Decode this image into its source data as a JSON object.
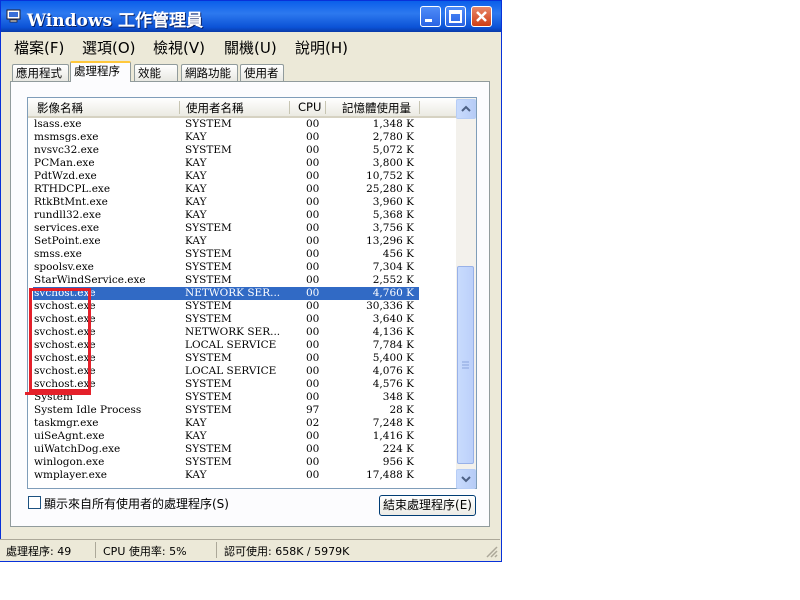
{
  "window": {
    "title": "Windows 工作管理員",
    "icon": "monitor-icon",
    "controls": [
      "minimize-icon",
      "maximize-icon",
      "close-icon"
    ]
  },
  "menu": [
    "檔案(F)",
    "選項(O)",
    "檢視(V)",
    "關機(U)",
    "說明(H)"
  ],
  "tabs": [
    {
      "label": "應用程式",
      "active": false
    },
    {
      "label": "處理程序",
      "active": true
    },
    {
      "label": "效能",
      "active": false
    },
    {
      "label": "網路功能",
      "active": false
    },
    {
      "label": "使用者",
      "active": false
    }
  ],
  "columns": [
    "影像名稱",
    "使用者名稱",
    "CPU",
    "記憶體使用量"
  ],
  "processes": [
    {
      "name": "lsass.exe",
      "user": "SYSTEM",
      "cpu": "00",
      "mem": "1,348 K"
    },
    {
      "name": "msmsgs.exe",
      "user": "KAY",
      "cpu": "00",
      "mem": "2,780 K"
    },
    {
      "name": "nvsvc32.exe",
      "user": "SYSTEM",
      "cpu": "00",
      "mem": "5,072 K"
    },
    {
      "name": "PCMan.exe",
      "user": "KAY",
      "cpu": "00",
      "mem": "3,800 K"
    },
    {
      "name": "PdtWzd.exe",
      "user": "KAY",
      "cpu": "00",
      "mem": "10,752 K"
    },
    {
      "name": "RTHDCPL.exe",
      "user": "KAY",
      "cpu": "00",
      "mem": "25,280 K"
    },
    {
      "name": "RtkBtMnt.exe",
      "user": "KAY",
      "cpu": "00",
      "mem": "3,960 K"
    },
    {
      "name": "rundll32.exe",
      "user": "KAY",
      "cpu": "00",
      "mem": "5,368 K"
    },
    {
      "name": "services.exe",
      "user": "SYSTEM",
      "cpu": "00",
      "mem": "3,756 K"
    },
    {
      "name": "SetPoint.exe",
      "user": "KAY",
      "cpu": "00",
      "mem": "13,296 K"
    },
    {
      "name": "smss.exe",
      "user": "SYSTEM",
      "cpu": "00",
      "mem": "456 K"
    },
    {
      "name": "spoolsv.exe",
      "user": "SYSTEM",
      "cpu": "00",
      "mem": "7,304 K"
    },
    {
      "name": "StarWindService.exe",
      "user": "SYSTEM",
      "cpu": "00",
      "mem": "2,552 K"
    },
    {
      "name": "svchost.exe",
      "user": "NETWORK SER...",
      "cpu": "00",
      "mem": "4,760 K",
      "selected": true
    },
    {
      "name": "svchost.exe",
      "user": "SYSTEM",
      "cpu": "00",
      "mem": "30,336 K"
    },
    {
      "name": "svchost.exe",
      "user": "SYSTEM",
      "cpu": "00",
      "mem": "3,640 K"
    },
    {
      "name": "svchost.exe",
      "user": "NETWORK SER...",
      "cpu": "00",
      "mem": "4,136 K"
    },
    {
      "name": "svchost.exe",
      "user": "LOCAL SERVICE",
      "cpu": "00",
      "mem": "7,784 K"
    },
    {
      "name": "svchost.exe",
      "user": "SYSTEM",
      "cpu": "00",
      "mem": "5,400 K"
    },
    {
      "name": "svchost.exe",
      "user": "LOCAL SERVICE",
      "cpu": "00",
      "mem": "4,076 K"
    },
    {
      "name": "svchost.exe",
      "user": "SYSTEM",
      "cpu": "00",
      "mem": "4,576 K"
    },
    {
      "name": "System",
      "user": "SYSTEM",
      "cpu": "00",
      "mem": "348 K"
    },
    {
      "name": "System Idle Process",
      "user": "SYSTEM",
      "cpu": "97",
      "mem": "28 K"
    },
    {
      "name": "taskmgr.exe",
      "user": "KAY",
      "cpu": "02",
      "mem": "7,248 K"
    },
    {
      "name": "uiSeAgnt.exe",
      "user": "KAY",
      "cpu": "00",
      "mem": "1,416 K"
    },
    {
      "name": "uiWatchDog.exe",
      "user": "SYSTEM",
      "cpu": "00",
      "mem": "224 K"
    },
    {
      "name": "winlogon.exe",
      "user": "SYSTEM",
      "cpu": "00",
      "mem": "956 K"
    },
    {
      "name": "wmplayer.exe",
      "user": "KAY",
      "cpu": "00",
      "mem": "17,488 K"
    }
  ],
  "show_all_users_label": "顯示來自所有使用者的處理程序(S)",
  "show_all_users_checked": false,
  "end_process_label": "結束處理程序(E)",
  "status": {
    "processes": "處理程序: 49",
    "cpu": "CPU 使用率: 5%",
    "commit": "認可使用: 658K / 5979K"
  },
  "colors": {
    "title_bar": "#0a5fea",
    "selection": "#316ac5",
    "annotation": "#e4202a"
  }
}
